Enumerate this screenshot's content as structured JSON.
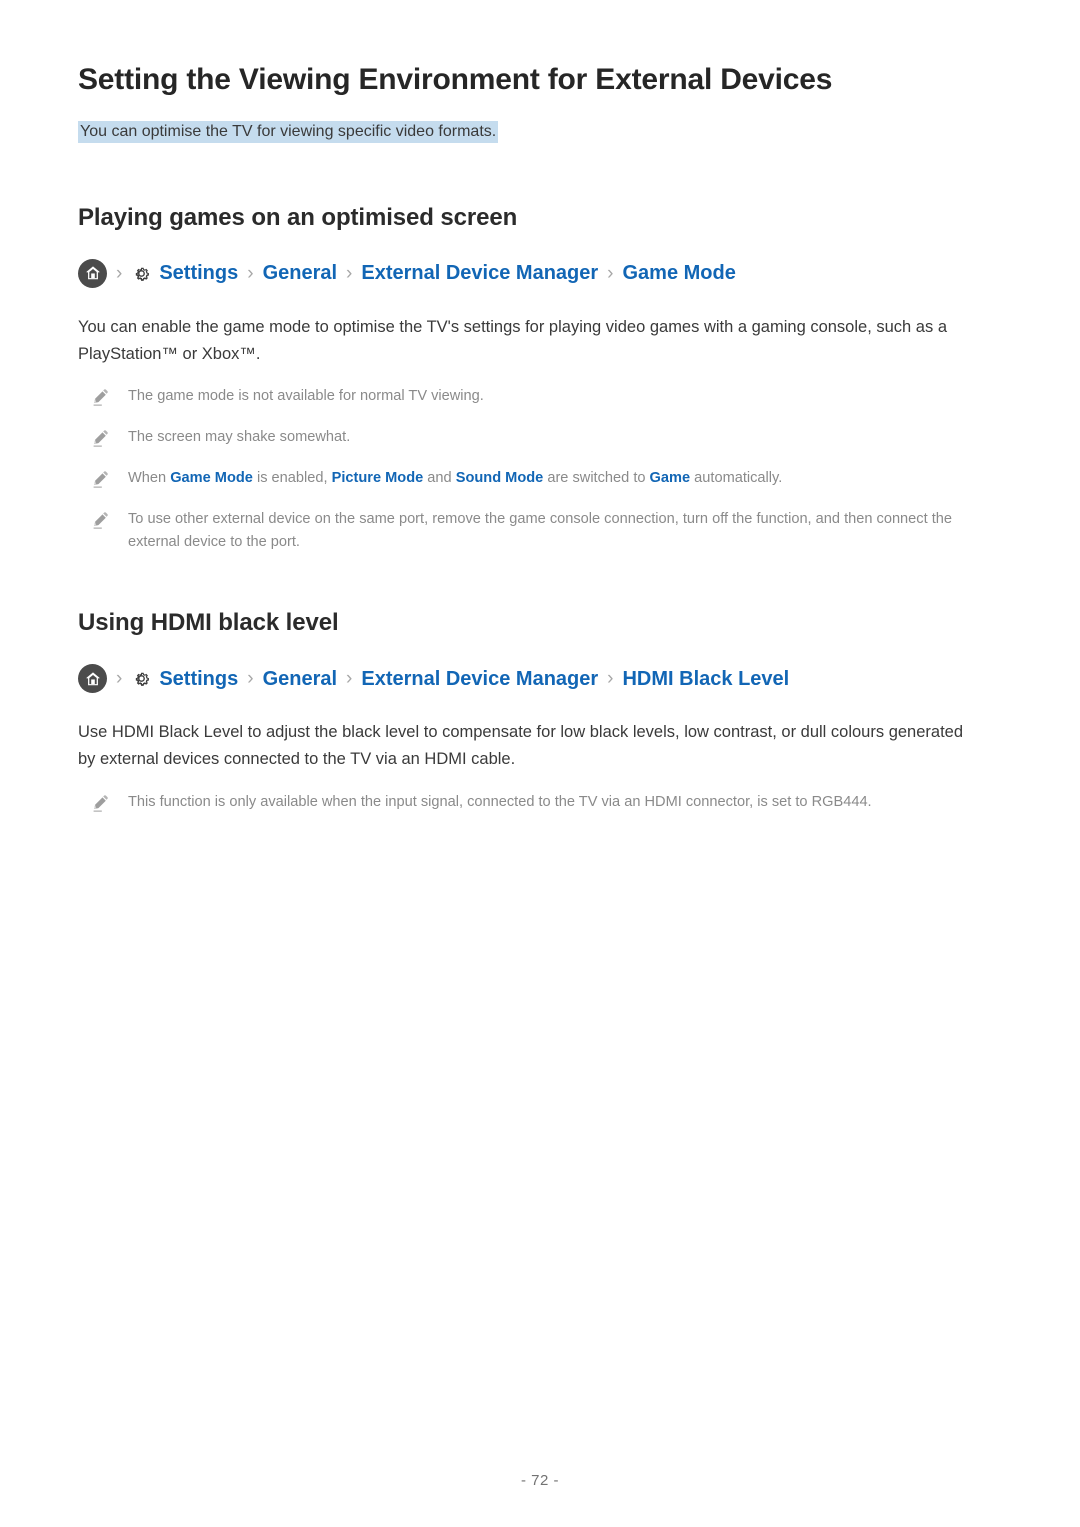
{
  "document": {
    "title": "Setting the Viewing Environment for External Devices",
    "subtitle": "You can optimise the TV for viewing specific video formats.",
    "page_number": "- 72 -"
  },
  "colors": {
    "link_blue": "#1266b5",
    "highlight": "#c5dcee",
    "heading": "#2b2b2b",
    "body": "#3a3a3a",
    "note": "#8a8a8a",
    "home_circle": "#4b4b4b",
    "separator": "#a8a8a8"
  },
  "sections": [
    {
      "heading": "Playing games on an optimised screen",
      "breadcrumb": {
        "home_icon": "home-icon",
        "gear_icon": "gear-icon",
        "separator": "›",
        "items": [
          "Settings",
          "General",
          "External Device Manager",
          "Game Mode"
        ]
      },
      "body": "You can enable the game mode to optimise the TV's settings for playing video games with a gaming console, such as a PlayStation™ or Xbox™.",
      "notes": [
        {
          "icon": "pencil-icon",
          "parts": [
            {
              "text": "The game mode is not available for normal TV viewing.",
              "emphasis": false
            }
          ]
        },
        {
          "icon": "pencil-icon",
          "parts": [
            {
              "text": "The screen may shake somewhat.",
              "emphasis": false
            }
          ]
        },
        {
          "icon": "pencil-icon",
          "parts": [
            {
              "text": "When ",
              "emphasis": false
            },
            {
              "text": "Game Mode",
              "emphasis": true
            },
            {
              "text": " is enabled, ",
              "emphasis": false
            },
            {
              "text": "Picture Mode",
              "emphasis": true
            },
            {
              "text": " and ",
              "emphasis": false
            },
            {
              "text": "Sound Mode",
              "emphasis": true
            },
            {
              "text": " are switched to ",
              "emphasis": false
            },
            {
              "text": "Game",
              "emphasis": true
            },
            {
              "text": " automatically.",
              "emphasis": false
            }
          ]
        },
        {
          "icon": "pencil-icon",
          "parts": [
            {
              "text": "To use other external device on the same port, remove the game console connection, turn off the function, and then connect the external device to the port.",
              "emphasis": false
            }
          ]
        }
      ]
    },
    {
      "heading": "Using HDMI black level",
      "breadcrumb": {
        "home_icon": "home-icon",
        "gear_icon": "gear-icon",
        "separator": "›",
        "items": [
          "Settings",
          "General",
          "External Device Manager",
          "HDMI Black Level"
        ]
      },
      "body": "Use HDMI Black Level to adjust the black level to compensate for low black levels, low contrast, or dull colours generated by external devices connected to the TV via an HDMI cable.",
      "notes": [
        {
          "icon": "pencil-icon",
          "parts": [
            {
              "text": "This function is only available when the input signal, connected to the TV via an HDMI connector, is set to RGB444.",
              "emphasis": false
            }
          ]
        }
      ]
    }
  ]
}
